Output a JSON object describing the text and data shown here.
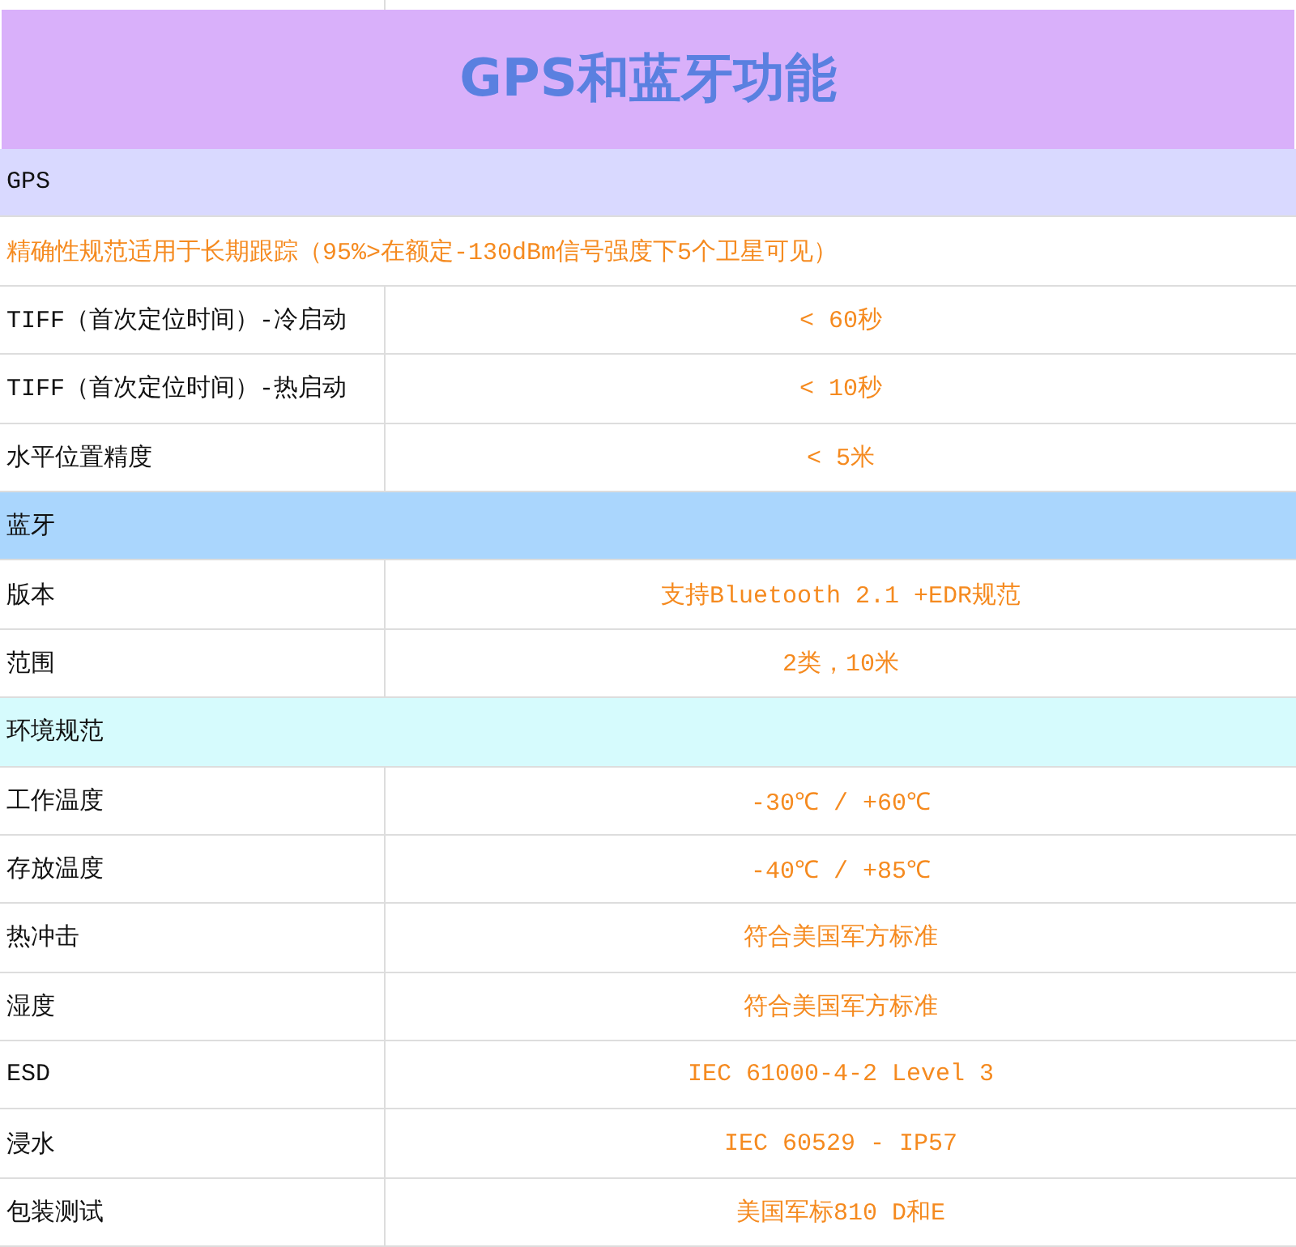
{
  "title": "GPS和蓝牙功能",
  "rows": [
    {
      "kind": "section",
      "label": "GPS",
      "color": "#d9d9ff"
    },
    {
      "kind": "note",
      "label": "精确性规范适用于长期跟踪（95%>在额定-130dBm信号强度下5个卫星可见）"
    },
    {
      "kind": "spec",
      "label": "TIFF（首次定位时间）-冷启动",
      "value": "< 60秒"
    },
    {
      "kind": "spec",
      "label": "TIFF（首次定位时间）-热启动",
      "value": "< 10秒"
    },
    {
      "kind": "spec",
      "label": "水平位置精度",
      "value": "< 5米"
    },
    {
      "kind": "section",
      "label": "蓝牙",
      "color": "#aad6fd"
    },
    {
      "kind": "spec",
      "label": "版本",
      "value": "支持Bluetooth 2.1 +EDR规范"
    },
    {
      "kind": "spec",
      "label": "范围",
      "value": "2类，10米"
    },
    {
      "kind": "section",
      "label": "环境规范",
      "color": "#d6fbfd"
    },
    {
      "kind": "spec",
      "label": "工作温度",
      "value": "-30℃ / +60℃"
    },
    {
      "kind": "spec",
      "label": "存放温度",
      "value": "-40℃ / +85℃"
    },
    {
      "kind": "spec",
      "label": "热冲击",
      "value": "符合美国军方标准"
    },
    {
      "kind": "spec",
      "label": "湿度",
      "value": "符合美国军方标准"
    },
    {
      "kind": "spec",
      "label": "ESD",
      "value": "IEC 61000-4-2 Level 3"
    },
    {
      "kind": "spec",
      "label": "浸水",
      "value": "IEC 60529 - IP57"
    },
    {
      "kind": "spec",
      "label": "包装测试",
      "value": "美国军标810 D和E"
    }
  ]
}
